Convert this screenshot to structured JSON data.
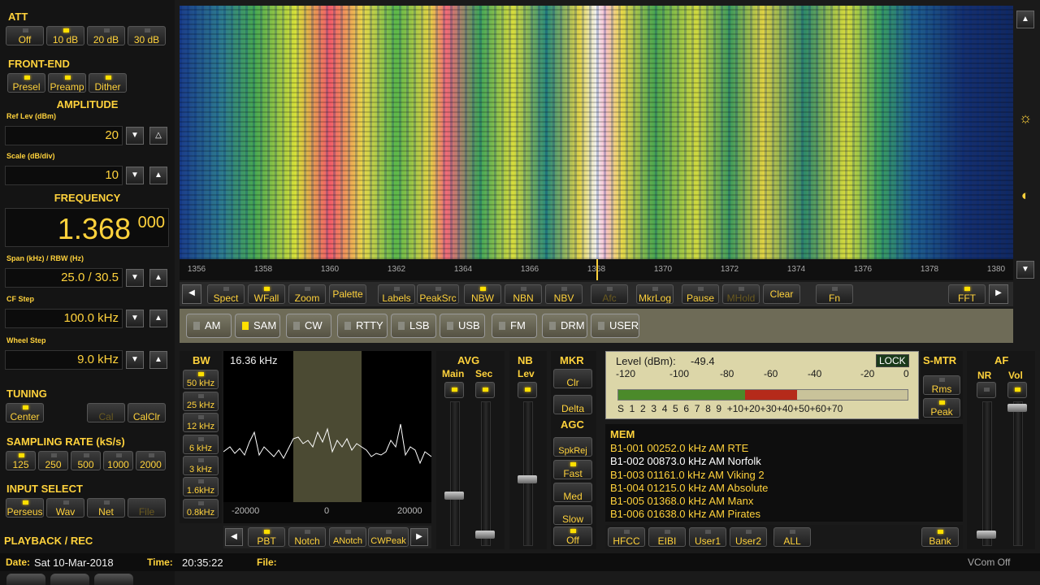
{
  "att": {
    "title": "ATT",
    "buttons": [
      {
        "label": "Off",
        "on": false
      },
      {
        "label": "10 dB",
        "on": true
      },
      {
        "label": "20 dB",
        "on": false
      },
      {
        "label": "30 dB",
        "on": false
      }
    ]
  },
  "frontend": {
    "title": "FRONT-END",
    "buttons": [
      {
        "label": "Presel",
        "on": true
      },
      {
        "label": "Preamp",
        "on": true
      },
      {
        "label": "Dither",
        "on": true
      }
    ]
  },
  "amplitude": {
    "title": "AMPLITUDE",
    "ref_label": "Ref Lev (dBm)",
    "ref_value": "20",
    "scale_label": "Scale (dB/div)",
    "scale_value": "10"
  },
  "frequency": {
    "title": "FREQUENCY",
    "main": "1.368",
    "sub": "000"
  },
  "span": {
    "label": "Span (kHz) / RBW (Hz)",
    "value": "25.0 / 30.5"
  },
  "cfstep": {
    "label": "CF Step",
    "value": "100.0 kHz"
  },
  "wheel": {
    "label": "Wheel Step",
    "value": "9.0 kHz"
  },
  "tuning": {
    "title": "TUNING",
    "buttons": [
      {
        "label": "Center",
        "on": true
      },
      {
        "label": "Cal",
        "on": false,
        "disabled": true
      },
      {
        "label": "CalClr",
        "on": false
      }
    ]
  },
  "sampling": {
    "title": "SAMPLING RATE (kS/s)",
    "buttons": [
      {
        "label": "125",
        "on": true
      },
      {
        "label": "250",
        "on": false
      },
      {
        "label": "500",
        "on": false
      },
      {
        "label": "1000",
        "on": false
      },
      {
        "label": "2000",
        "on": false
      }
    ]
  },
  "input": {
    "title": "INPUT SELECT",
    "buttons": [
      {
        "label": "Perseus",
        "on": true
      },
      {
        "label": "Wav",
        "on": false
      },
      {
        "label": "Net",
        "on": false
      },
      {
        "label": "File",
        "on": false,
        "disabled": true
      }
    ]
  },
  "playback": {
    "title": "PLAYBACK / REC"
  },
  "axis_ticks": [
    "1356",
    "1358",
    "1360",
    "1362",
    "1364",
    "1366",
    "1368",
    "1370",
    "1372",
    "1374",
    "1376",
    "1378",
    "1380"
  ],
  "toolbar": {
    "buttons": [
      "Spect",
      "WFall",
      "Zoom",
      "Palette",
      "Labels",
      "PeakSrc",
      "NBW",
      "NBN",
      "NBV",
      "Afc",
      "MkrLog",
      "Pause",
      "MHold",
      "Clear",
      "Fn",
      "FFT"
    ]
  },
  "modes": [
    {
      "label": "AM",
      "on": false
    },
    {
      "label": "SAM",
      "on": true
    },
    {
      "label": "CW",
      "on": false
    },
    {
      "label": "RTTY",
      "on": false
    },
    {
      "label": "LSB",
      "on": false
    },
    {
      "label": "USB",
      "on": false
    },
    {
      "label": "FM",
      "on": false
    },
    {
      "label": "DRM",
      "on": false
    },
    {
      "label": "USER",
      "on": false
    }
  ],
  "bw": {
    "title": "BW",
    "buttons": [
      "50 kHz",
      "25 kHz",
      "12 kHz",
      "6 kHz",
      "3 kHz",
      "1.6kHz",
      "0.8kHz"
    ],
    "readout": "16.36 kHz",
    "x_labels": [
      "-20000",
      "0",
      "20000"
    ]
  },
  "filter_bar": {
    "buttons": [
      "PBT",
      "Notch",
      "ANotch",
      "CWPeak"
    ]
  },
  "avg": {
    "title": "AVG",
    "main": "Main",
    "sec": "Sec"
  },
  "nb": {
    "title": "NB",
    "lev": "Lev"
  },
  "mkr": {
    "title": "MKR",
    "buttons": [
      "Clr",
      "Delta"
    ]
  },
  "agc": {
    "title": "AGC",
    "buttons": [
      "SpkRej",
      "Fast",
      "Med",
      "Slow",
      "Off"
    ]
  },
  "meter": {
    "level_label": "Level (dBm):",
    "level_value": "-49.4",
    "lock": "LOCK",
    "dbm_scale": [
      "-120",
      "-100",
      "-80",
      "-60",
      "-40",
      "-20",
      "0"
    ],
    "s_scale": "S  1  2  3  4  5  6  7  8  9  +10+20+30+40+50+60+70"
  },
  "smtr": {
    "title": "S-MTR",
    "buttons": [
      "Rms",
      "Peak"
    ]
  },
  "af": {
    "title": "AF",
    "nr": "NR",
    "vol": "Vol"
  },
  "mem": {
    "title": "MEM",
    "items": [
      "B1-001 00252.0 kHz  AM  RTE",
      "B1-002 00873.0 kHz  AM  Norfolk",
      "B1-003 01161.0 kHz  AM  Viking 2",
      "B1-004 01215.0 kHz  AM  Absolute",
      "B1-005 01368.0 kHz  AM  Manx",
      "B1-006 01638.0 kHz  AM  Pirates"
    ],
    "buttons": [
      "HFCC",
      "EIBI",
      "User1",
      "User2",
      "ALL",
      "Bank"
    ]
  },
  "status": {
    "date_label": "Date:",
    "date": "Sat 10-Mar-2018",
    "time_label": "Time:",
    "time": "20:35:22",
    "file_label": "File:",
    "vcom": "VCom Off"
  }
}
